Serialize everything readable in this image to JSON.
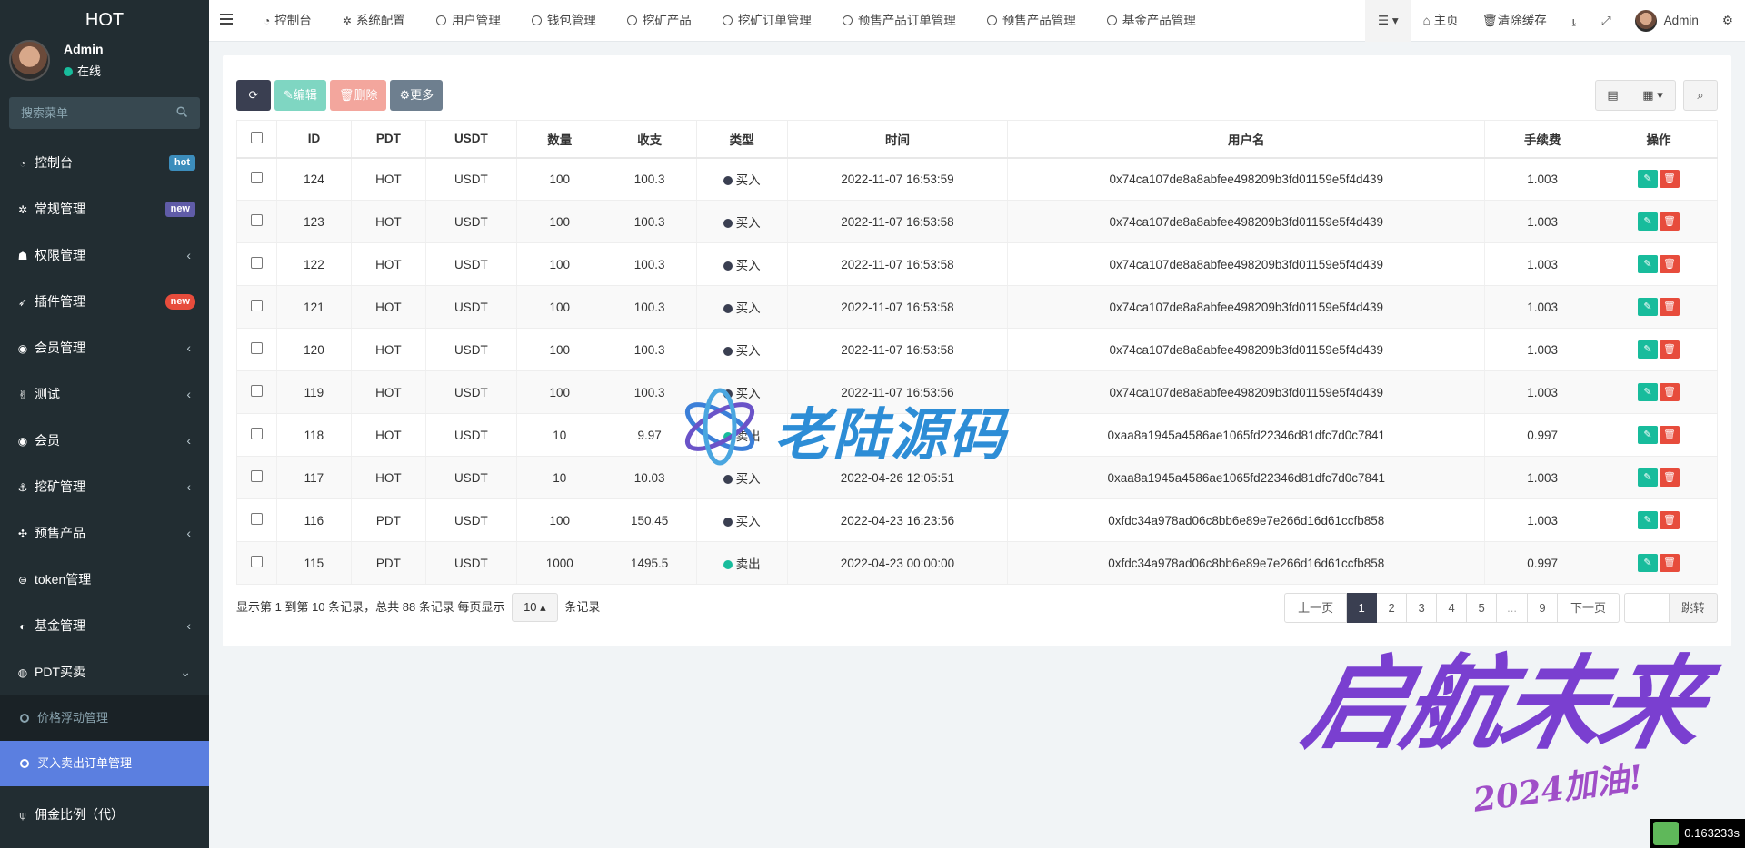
{
  "app": {
    "brand": "HOT"
  },
  "user": {
    "name": "Admin",
    "status": "在线"
  },
  "search": {
    "placeholder": "搜索菜单"
  },
  "sidebar": {
    "items": [
      {
        "label": "控制台",
        "badge": "hot",
        "icon": "dashboard-icon"
      },
      {
        "label": "常规管理",
        "badge": "new",
        "icon": "cogs-icon"
      },
      {
        "label": "权限管理",
        "icon": "group-icon"
      },
      {
        "label": "插件管理",
        "badge": "new",
        "icon": "rocket-icon"
      },
      {
        "label": "会员管理",
        "icon": "user-circle-icon"
      },
      {
        "label": "测试",
        "icon": "hand-icon"
      },
      {
        "label": "会员",
        "icon": "user-circle-icon"
      },
      {
        "label": "挖矿管理",
        "icon": "anchor-icon"
      },
      {
        "label": "预售产品",
        "icon": "pinwheel-icon"
      },
      {
        "label": "token管理",
        "icon": "token-icon"
      },
      {
        "label": "基金管理",
        "icon": "adjust-icon"
      },
      {
        "label": "PDT买卖",
        "icon": "compass-icon"
      }
    ],
    "sub_items": [
      {
        "label": "价格浮动管理"
      },
      {
        "label": "买入卖出订单管理"
      }
    ],
    "last_item": {
      "label": "佣金比例（代）",
      "icon": "pin-icon"
    }
  },
  "navbar": {
    "tabs": [
      {
        "label": "控制台"
      },
      {
        "label": "系统配置"
      },
      {
        "label": "用户管理"
      },
      {
        "label": "钱包管理"
      },
      {
        "label": "挖矿产品"
      },
      {
        "label": "挖矿订单管理"
      },
      {
        "label": "预售产品订单管理"
      },
      {
        "label": "预售产品管理"
      },
      {
        "label": "基金产品管理"
      }
    ],
    "home": "主页",
    "clear_cache": "清除缓存",
    "admin": "Admin"
  },
  "toolbar": {
    "edit": "编辑",
    "delete": "删除",
    "more": "更多"
  },
  "table": {
    "headers": [
      "ID",
      "PDT",
      "USDT",
      "数量",
      "收支",
      "类型",
      "时间",
      "用户名",
      "手续费",
      "操作"
    ],
    "rows": [
      {
        "id": "124",
        "pdt": "HOT",
        "usdt": "USDT",
        "qty": "100",
        "amount": "100.3",
        "type": "买入",
        "time": "2022-11-07 16:53:59",
        "user": "0x74ca107de8a8abfee498209b3fd01159e5f4d439",
        "fee": "1.003"
      },
      {
        "id": "123",
        "pdt": "HOT",
        "usdt": "USDT",
        "qty": "100",
        "amount": "100.3",
        "type": "买入",
        "time": "2022-11-07 16:53:58",
        "user": "0x74ca107de8a8abfee498209b3fd01159e5f4d439",
        "fee": "1.003"
      },
      {
        "id": "122",
        "pdt": "HOT",
        "usdt": "USDT",
        "qty": "100",
        "amount": "100.3",
        "type": "买入",
        "time": "2022-11-07 16:53:58",
        "user": "0x74ca107de8a8abfee498209b3fd01159e5f4d439",
        "fee": "1.003"
      },
      {
        "id": "121",
        "pdt": "HOT",
        "usdt": "USDT",
        "qty": "100",
        "amount": "100.3",
        "type": "买入",
        "time": "2022-11-07 16:53:58",
        "user": "0x74ca107de8a8abfee498209b3fd01159e5f4d439",
        "fee": "1.003"
      },
      {
        "id": "120",
        "pdt": "HOT",
        "usdt": "USDT",
        "qty": "100",
        "amount": "100.3",
        "type": "买入",
        "time": "2022-11-07 16:53:58",
        "user": "0x74ca107de8a8abfee498209b3fd01159e5f4d439",
        "fee": "1.003"
      },
      {
        "id": "119",
        "pdt": "HOT",
        "usdt": "USDT",
        "qty": "100",
        "amount": "100.3",
        "type": "买入",
        "time": "2022-11-07 16:53:56",
        "user": "0x74ca107de8a8abfee498209b3fd01159e5f4d439",
        "fee": "1.003"
      },
      {
        "id": "118",
        "pdt": "HOT",
        "usdt": "USDT",
        "qty": "10",
        "amount": "9.97",
        "type": "卖出",
        "time": "",
        "user": "0xaa8a1945a4586ae1065fd22346d81dfc7d0c7841",
        "fee": "0.997"
      },
      {
        "id": "117",
        "pdt": "HOT",
        "usdt": "USDT",
        "qty": "10",
        "amount": "10.03",
        "type": "买入",
        "time": "2022-04-26 12:05:51",
        "user": "0xaa8a1945a4586ae1065fd22346d81dfc7d0c7841",
        "fee": "1.003"
      },
      {
        "id": "116",
        "pdt": "PDT",
        "usdt": "USDT",
        "qty": "100",
        "amount": "150.45",
        "type": "买入",
        "time": "2022-04-23 16:23:56",
        "user": "0xfdc34a978ad06c8bb6e89e7e266d16d61ccfb858",
        "fee": "1.003"
      },
      {
        "id": "115",
        "pdt": "PDT",
        "usdt": "USDT",
        "qty": "1000",
        "amount": "1495.5",
        "type": "卖出",
        "time": "2022-04-23 00:00:00",
        "user": "0xfdc34a978ad06c8bb6e89e7e266d16d61ccfb858",
        "fee": "0.997"
      }
    ]
  },
  "pager": {
    "info_prefix": "显示第 1 到第 10 条记录，总共 88 条记录 每页显示",
    "page_size": "10",
    "info_suffix": "条记录",
    "prev": "上一页",
    "pages": [
      "1",
      "2",
      "3",
      "4",
      "5",
      "...",
      "9"
    ],
    "next": "下一页",
    "go": "跳转"
  },
  "watermark": {
    "main": "老陆源码",
    "script": "启航未来",
    "sub": "2024加油!"
  },
  "timer": "0.163233s",
  "colors": {
    "sidebar": "#222d32",
    "accent": "#3a3f51",
    "success": "#18bc9c",
    "danger": "#e74c3c",
    "active_menu": "#5b7fe0"
  }
}
